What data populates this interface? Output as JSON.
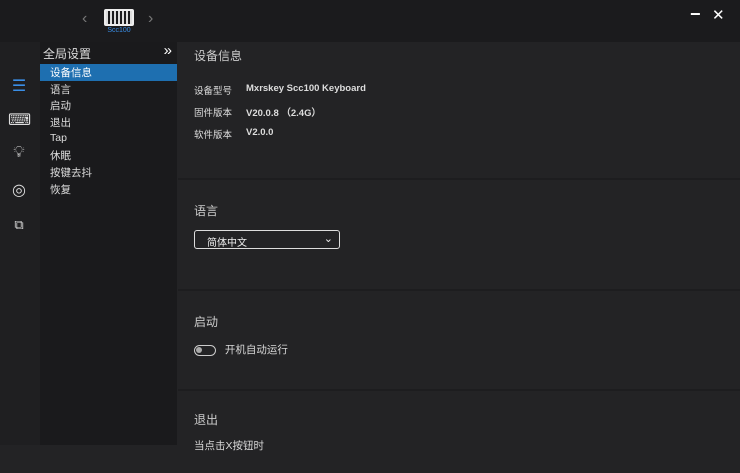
{
  "device": {
    "name": "Scc100"
  },
  "window": {
    "minimize": "−",
    "close": "✕"
  },
  "sidebar": {
    "title": "全局设置",
    "expand": "»",
    "items": [
      {
        "label": "设备信息"
      },
      {
        "label": "语言"
      },
      {
        "label": "启动"
      },
      {
        "label": "退出"
      },
      {
        "label": "Tap"
      },
      {
        "label": "休眠"
      },
      {
        "label": "按键去抖"
      },
      {
        "label": "恢复"
      }
    ]
  },
  "info": {
    "title": "设备信息",
    "rows": [
      {
        "k": "设备型号",
        "v": "Mxrskey Scc100 Keyboard"
      },
      {
        "k": "固件版本",
        "v": "V20.0.8 （2.4G）"
      },
      {
        "k": "软件版本",
        "v": "V2.0.0"
      }
    ]
  },
  "language": {
    "title": "语言",
    "value": "简体中文"
  },
  "startup": {
    "title": "启动",
    "toggle_label": "开机自动运行",
    "enabled": false
  },
  "exit": {
    "title": "退出",
    "text": "当点击X按钮时"
  }
}
